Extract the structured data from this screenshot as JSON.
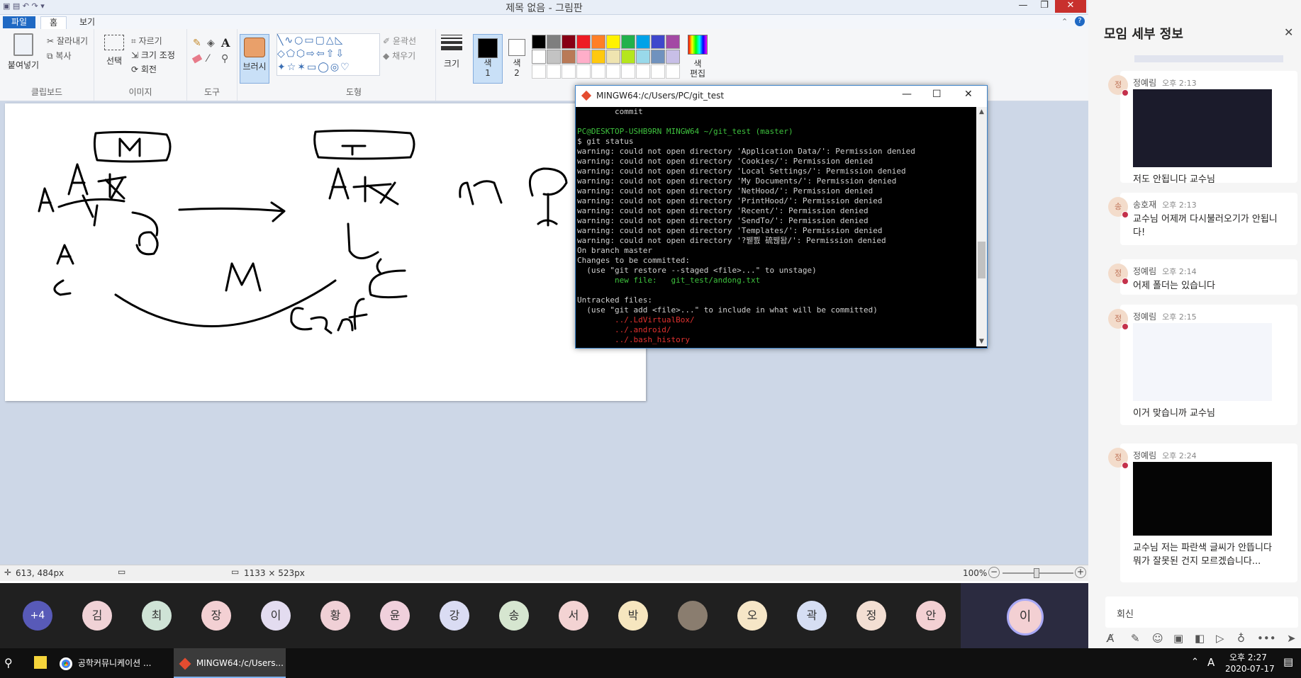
{
  "paint": {
    "title": "제목 없음 - 그림판",
    "menu": {
      "file": "파일",
      "home": "홈",
      "view": "보기"
    },
    "ribbon": {
      "paste": "붙여넣기",
      "cut": "잘라내기",
      "copy": "복사",
      "clipboard_label": "클립보드",
      "select": "선택",
      "crop": "자르기",
      "resize": "크기 조정",
      "rotate": "회전",
      "image_label": "이미지",
      "tools_label": "도구",
      "brush": "브러시",
      "outline": "윤곽선",
      "fill": "채우기",
      "shapes_label": "도형",
      "size": "크기",
      "color1": "색\n1",
      "color2": "색\n2",
      "edit_colors": "색\n편집",
      "palette": [
        "#000000",
        "#7f7f7f",
        "#880015",
        "#ed1c24",
        "#ff7f27",
        "#fff200",
        "#22b14c",
        "#00a2e8",
        "#3f48cc",
        "#a349a4",
        "#ffffff",
        "#c3c3c3",
        "#b97a57",
        "#ffaec9",
        "#ffc90e",
        "#efe4b0",
        "#b5e61d",
        "#99d9ea",
        "#7092be",
        "#c8bfe7"
      ]
    },
    "status": {
      "cursor": "613, 484px",
      "dimensions": "1133 × 523px",
      "zoom": "100%"
    }
  },
  "terminal": {
    "title": "MINGW64:/c/Users/PC/git_test",
    "lines": [
      {
        "t": "        commit",
        "c": "#d0d0d0"
      },
      {
        "t": "",
        "c": "#d0d0d0"
      },
      {
        "t": "PC@DESKTOP-USHB9RN MINGW64 ~/git_test (master)",
        "c": "#3ec23e"
      },
      {
        "t": "$ git status",
        "c": "#d0d0d0"
      },
      {
        "t": "warning: could not open directory 'Application Data/': Permission denied",
        "c": "#d0d0d0"
      },
      {
        "t": "warning: could not open directory 'Cookies/': Permission denied",
        "c": "#d0d0d0"
      },
      {
        "t": "warning: could not open directory 'Local Settings/': Permission denied",
        "c": "#d0d0d0"
      },
      {
        "t": "warning: could not open directory 'My Documents/': Permission denied",
        "c": "#d0d0d0"
      },
      {
        "t": "warning: could not open directory 'NetHood/': Permission denied",
        "c": "#d0d0d0"
      },
      {
        "t": "warning: could not open directory 'PrintHood/': Permission denied",
        "c": "#d0d0d0"
      },
      {
        "t": "warning: could not open directory 'Recent/': Permission denied",
        "c": "#d0d0d0"
      },
      {
        "t": "warning: could not open directory 'SendTo/': Permission denied",
        "c": "#d0d0d0"
      },
      {
        "t": "warning: could not open directory 'Templates/': Permission denied",
        "c": "#d0d0d0"
      },
      {
        "t": "warning: could not open directory '?붿뿴 硫붾돱/': Permission denied",
        "c": "#d0d0d0"
      },
      {
        "t": "On branch master",
        "c": "#d0d0d0"
      },
      {
        "t": "Changes to be committed:",
        "c": "#d0d0d0"
      },
      {
        "t": "  (use \"git restore --staged <file>...\" to unstage)",
        "c": "#d0d0d0"
      },
      {
        "t": "        new file:   git_test/andong.txt",
        "c": "#3ec23e"
      },
      {
        "t": "",
        "c": "#d0d0d0"
      },
      {
        "t": "Untracked files:",
        "c": "#d0d0d0"
      },
      {
        "t": "  (use \"git add <file>...\" to include in what will be committed)",
        "c": "#d0d0d0"
      },
      {
        "t": "        ../.LdVirtualBox/",
        "c": "#e0312f"
      },
      {
        "t": "        ../.android/",
        "c": "#e0312f"
      },
      {
        "t": "        ../.bash_history",
        "c": "#e0312f"
      }
    ]
  },
  "participants": {
    "overflow": "+4",
    "list": [
      {
        "initial": "김",
        "bg": "#f0d2d6"
      },
      {
        "initial": "최",
        "bg": "#cfe3d6"
      },
      {
        "initial": "장",
        "bg": "#f3d0d3"
      },
      {
        "initial": "이",
        "bg": "#e3dcf0"
      },
      {
        "initial": "황",
        "bg": "#f0d0d6"
      },
      {
        "initial": "윤",
        "bg": "#f0d0dc"
      },
      {
        "initial": "강",
        "bg": "#dadcf3"
      },
      {
        "initial": "송",
        "bg": "#d6e6d0"
      },
      {
        "initial": "서",
        "bg": "#f3d3d3"
      },
      {
        "initial": "박",
        "bg": "#f6e6bf"
      },
      {
        "initial": "",
        "bg": "#8a7d6f"
      },
      {
        "initial": "오",
        "bg": "#f6e6c7"
      },
      {
        "initial": "곽",
        "bg": "#d6def3"
      },
      {
        "initial": "정",
        "bg": "#f3dfd3"
      },
      {
        "initial": "안",
        "bg": "#f3d0d3"
      }
    ],
    "self": "이"
  },
  "taskbar": {
    "chrome": "공학커뮤니케이션 ...",
    "git": "MINGW64:/c/Users...",
    "ime": "A",
    "time": "오후 2:27",
    "date": "2020-07-17"
  },
  "chat": {
    "title": "모임 세부 정보",
    "messages": [
      {
        "initial": "정",
        "name": "정예림",
        "time": "오후 2:13",
        "text": "저도 안됩니다 교수님"
      },
      {
        "initial": "송",
        "name": "송호재",
        "time": "오후 2:13",
        "text": "교수님 어제꺼 다시불러오기가 안됩니다!"
      },
      {
        "initial": "정",
        "name": "정예림",
        "time": "오후 2:14",
        "text": "어제 폴더는 있습니다"
      },
      {
        "initial": "정",
        "name": "정예림",
        "time": "오후 2:15",
        "text": "이거 맞습니까 교수님"
      },
      {
        "initial": "정",
        "name": "정예림",
        "time": "오후 2:24",
        "text": "교수님 저는 파란색 글씨가 안뜹니다 뭐가 잘못된 건지 모르겠습니다..."
      }
    ],
    "reply": "회신"
  }
}
